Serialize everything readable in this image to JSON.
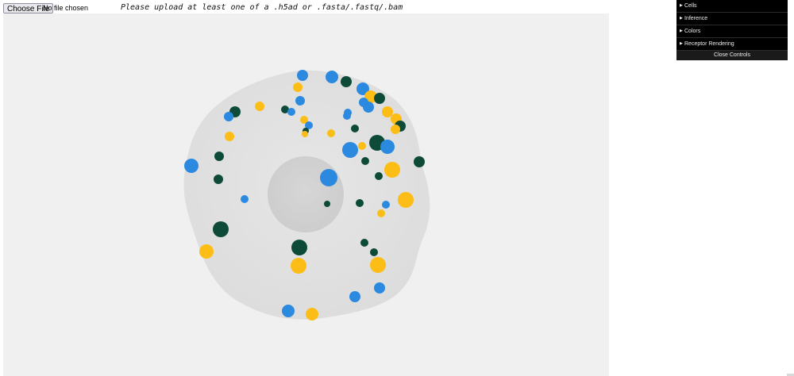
{
  "file_input": {
    "button_label": "Choose File",
    "status": "No file chosen"
  },
  "upload_message": "Please upload at least one of a .h5ad or .fasta/.fastq/.bam",
  "controls": {
    "folders": [
      {
        "label": "Cells"
      },
      {
        "label": "Inference"
      },
      {
        "label": "Colors"
      },
      {
        "label": "Receptor Rendering"
      }
    ],
    "close_label": "Close Controls"
  },
  "colors": {
    "viewport_bg": "#f0f0f0",
    "cell_body": "#e3e3e3",
    "nucleus": "#d2d2d2",
    "blue": "#2b8ae0",
    "yellow": "#fbbd16",
    "green": "#0d4a38"
  }
}
